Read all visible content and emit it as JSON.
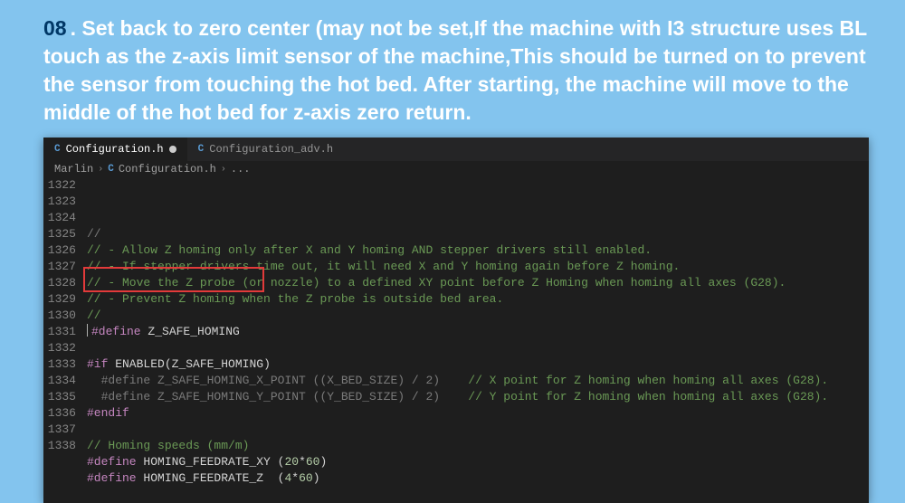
{
  "instruction": {
    "number": "08",
    "text": ". Set back to zero center (may not be set,If the machine with I3 structure uses BL touch as the z-axis limit sensor of the machine,This should be turned on to prevent the sensor from touching the hot bed. After starting, the machine will move to the middle of the hot bed for z-axis zero return."
  },
  "tabs": [
    {
      "icon": "C",
      "label": "Configuration.h",
      "dirty": true,
      "active": true
    },
    {
      "icon": "C",
      "label": "Configuration_adv.h",
      "dirty": false,
      "active": false
    }
  ],
  "breadcrumb": {
    "folder": "Marlin",
    "fileIcon": "C",
    "file": "Configuration.h",
    "trail": "..."
  },
  "code": {
    "startLine": 1322,
    "lines": [
      {
        "ln": 1322,
        "segs": [
          {
            "cls": "c-dim",
            "t": "//"
          }
        ]
      },
      {
        "ln": 1323,
        "segs": [
          {
            "cls": "c-comment",
            "t": "// - Allow Z homing only after X and Y homing AND stepper drivers still enabled."
          }
        ]
      },
      {
        "ln": 1324,
        "segs": [
          {
            "cls": "c-comment",
            "t": "// - If stepper drivers time out, it will need X and Y homing again before Z homing."
          }
        ]
      },
      {
        "ln": 1325,
        "segs": [
          {
            "cls": "c-comment",
            "t": "// - Move the Z probe (or nozzle) to a defined XY point before Z Homing when homing all axes (G28)."
          }
        ]
      },
      {
        "ln": 1326,
        "segs": [
          {
            "cls": "c-comment",
            "t": "// - Prevent Z homing when the Z probe is outside bed area."
          }
        ]
      },
      {
        "ln": 1327,
        "segs": [
          {
            "cls": "c-comment",
            "t": "//"
          }
        ]
      },
      {
        "ln": 1328,
        "highlight": true,
        "cursor": true,
        "segs": [
          {
            "cls": "c-keyword",
            "t": "#define"
          },
          {
            "cls": "c-ident",
            "t": " Z_SAFE_HOMING"
          }
        ]
      },
      {
        "ln": 1329,
        "segs": []
      },
      {
        "ln": 1330,
        "segs": [
          {
            "cls": "c-keyword",
            "t": "#if"
          },
          {
            "cls": "c-ident",
            "t": " ENABLED"
          },
          {
            "cls": "c-paren",
            "t": "("
          },
          {
            "cls": "c-ident",
            "t": "Z_SAFE_HOMING"
          },
          {
            "cls": "c-paren",
            "t": ")"
          }
        ]
      },
      {
        "ln": 1331,
        "segs": [
          {
            "cls": "c-dim",
            "t": "  #define Z_SAFE_HOMING_X_POINT ((X_BED_SIZE) / 2)    "
          },
          {
            "cls": "c-comment",
            "t": "// X point for Z homing when homing all axes (G28)."
          }
        ]
      },
      {
        "ln": 1332,
        "segs": [
          {
            "cls": "c-dim",
            "t": "  #define Z_SAFE_HOMING_Y_POINT ((Y_BED_SIZE) / 2)    "
          },
          {
            "cls": "c-comment",
            "t": "// Y point for Z homing when homing all axes (G28)."
          }
        ]
      },
      {
        "ln": 1333,
        "segs": [
          {
            "cls": "c-keyword",
            "t": "#endif"
          }
        ]
      },
      {
        "ln": 1334,
        "segs": []
      },
      {
        "ln": 1335,
        "segs": [
          {
            "cls": "c-comment",
            "t": "// Homing speeds (mm/m)"
          }
        ]
      },
      {
        "ln": 1336,
        "segs": [
          {
            "cls": "c-keyword",
            "t": "#define"
          },
          {
            "cls": "c-ident",
            "t": " HOMING_FEEDRATE_XY "
          },
          {
            "cls": "c-paren",
            "t": "("
          },
          {
            "cls": "c-number",
            "t": "20"
          },
          {
            "cls": "c-paren",
            "t": "*"
          },
          {
            "cls": "c-number",
            "t": "60"
          },
          {
            "cls": "c-paren",
            "t": ")"
          }
        ]
      },
      {
        "ln": 1337,
        "segs": [
          {
            "cls": "c-keyword",
            "t": "#define"
          },
          {
            "cls": "c-ident",
            "t": " HOMING_FEEDRATE_Z  "
          },
          {
            "cls": "c-paren",
            "t": "("
          },
          {
            "cls": "c-number",
            "t": "4"
          },
          {
            "cls": "c-paren",
            "t": "*"
          },
          {
            "cls": "c-number",
            "t": "60"
          },
          {
            "cls": "c-paren",
            "t": ")"
          }
        ]
      },
      {
        "ln": 1338,
        "segs": []
      }
    ]
  }
}
